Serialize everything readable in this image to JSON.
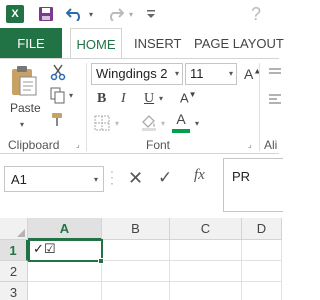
{
  "qat": {
    "app_icon": "X",
    "icons": [
      "excel-logo-icon",
      "save-icon",
      "undo-icon",
      "redo-icon",
      "customize-qat-icon"
    ]
  },
  "tabs": {
    "file": "FILE",
    "home": "HOME",
    "insert": "INSERT",
    "page_layout": "PAGE LAYOUT"
  },
  "ribbon": {
    "clipboard": {
      "paste_label": "Paste",
      "group_label": "Clipboard"
    },
    "font": {
      "font_name": "Wingdings 2",
      "font_size": "11",
      "bold": "B",
      "italic": "I",
      "underline": "U",
      "font_color_letter": "A",
      "group_label": "Font",
      "font_color": "#00a04a"
    },
    "alignment": {
      "group_label_partial": "Ali"
    }
  },
  "formula_bar": {
    "name_box": "A1",
    "fx_label": "fx",
    "formula": "PR"
  },
  "grid": {
    "columns": [
      "A",
      "B",
      "C",
      "D"
    ],
    "rows": [
      "1",
      "2",
      "3"
    ],
    "selected_cell_value": "✓☑"
  },
  "colors": {
    "accent": "#217346"
  }
}
